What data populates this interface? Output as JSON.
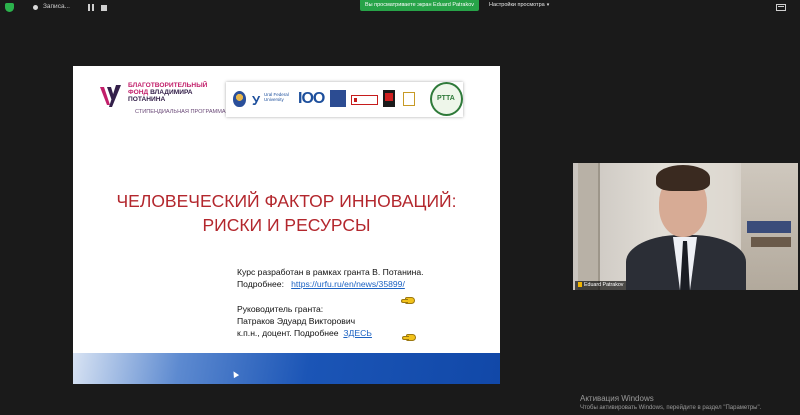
{
  "topbar": {
    "recording_label": "Записа...",
    "viewing_banner": "Вы просматриваете экран Eduard Patrakov",
    "view_options_label": "Настройки просмотра"
  },
  "slide": {
    "fund_name_line1": "БЛАГОТВОРИТЕЛЬНЫЙ",
    "fund_name_line2_a": "ФОНД ",
    "fund_name_line2_b": "ВЛАДИМИРА",
    "fund_name_line3": "ПОТАНИНА",
    "fund_program": "СТИПЕНДИАЛЬНАЯ ПРОГРАММА",
    "partner_text": "Ural Federal University",
    "partner_100": "IOO",
    "partner_pta": "PTTA",
    "title_line1": "ЧЕЛОВЕЧЕСКИЙ ФАКТОР ИННОВАЦИЙ:",
    "title_line2": "РИСКИ И РЕСУРСЫ",
    "course_line": "Курс разработан в рамках гранта В. Потанина.",
    "more_label": "Подробнее:",
    "more_link": "https://urfu.ru/en/news/35899/",
    "head_label": "Руководитель гранта:",
    "head_name": "Патраков Эдуард Викторович",
    "head_title": "к.п.н., доцент. Подробнее",
    "head_link": "ЗДЕСЬ"
  },
  "camera": {
    "name": "Eduard Patrakov"
  },
  "system": {
    "activation_title": "Активация Windows",
    "activation_text": "Чтобы активировать Windows, перейдите в раздел \"Параметры\"."
  },
  "colors": {
    "title_red": "#b3272d",
    "link_blue": "#1c62c2",
    "banner_green": "#27a348",
    "fund_magenta": "#c21f6a"
  },
  "icons": [
    "shield-icon",
    "recording-icon",
    "pause-icon",
    "stop-icon",
    "chevron-down-icon",
    "fullscreen-icon",
    "pointing-hand-icon",
    "microphone-icon"
  ]
}
